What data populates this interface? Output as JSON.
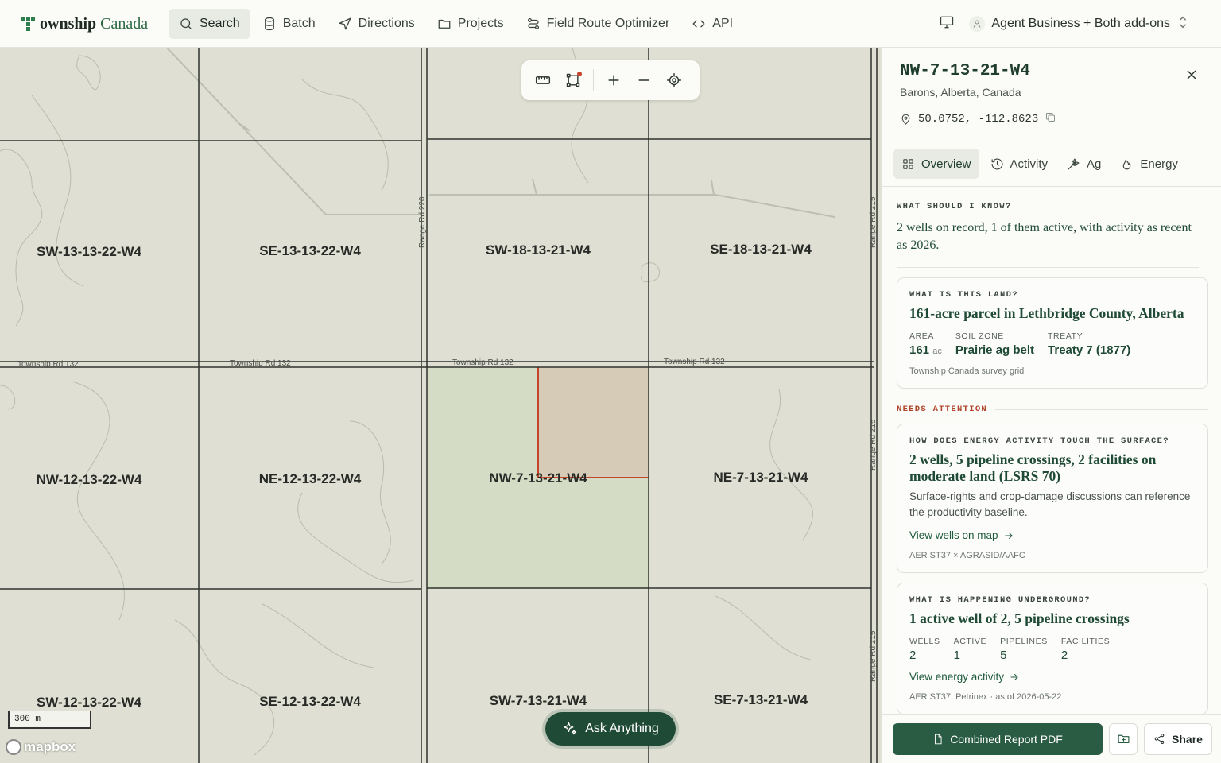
{
  "brand": {
    "name_bold": "ownship",
    "name_rest": " Canada"
  },
  "nav": {
    "items": [
      {
        "label": "Search",
        "icon": "search-icon",
        "active": true
      },
      {
        "label": "Batch",
        "icon": "database-icon"
      },
      {
        "label": "Directions",
        "icon": "navigation-icon"
      },
      {
        "label": "Projects",
        "icon": "folder-icon"
      },
      {
        "label": "Field Route Optimizer",
        "icon": "route-icon"
      },
      {
        "label": "API",
        "icon": "code-icon"
      }
    ],
    "account": "Agent Business + Both add-ons"
  },
  "map": {
    "parcels": [
      {
        "label": "SW-13-13-22-W4"
      },
      {
        "label": "SE-13-13-22-W4"
      },
      {
        "label": "SW-18-13-21-W4"
      },
      {
        "label": "SE-18-13-21-W4"
      },
      {
        "label": "NW-12-13-22-W4"
      },
      {
        "label": "NE-12-13-22-W4"
      },
      {
        "label": "NW-7-13-21-W4"
      },
      {
        "label": "NE-7-13-21-W4"
      },
      {
        "label": "SW-12-13-22-W4"
      },
      {
        "label": "SE-12-13-22-W4"
      },
      {
        "label": "SW-7-13-21-W4"
      },
      {
        "label": "SE-7-13-21-W4"
      }
    ],
    "roads": {
      "township": "Township Rd 132",
      "range_220": "Range Rd 220",
      "range_215": "Range Rd 215"
    },
    "scale": "300 m",
    "attribution": "mapbox",
    "ask_label": "Ask Anything",
    "colors": {
      "base": "#dfe0d3",
      "selected": "#d4dcc6",
      "highlight": "#d6cbb7",
      "highlight_border": "#c4452a"
    }
  },
  "panel": {
    "title": "NW-7-13-21-W4",
    "location": "Barons, Alberta, Canada",
    "coords": "50.0752, -112.8623",
    "tabs": [
      {
        "label": "Overview",
        "icon": "grid-icon",
        "active": true
      },
      {
        "label": "Activity",
        "icon": "history-icon"
      },
      {
        "label": "Ag",
        "icon": "wheat-icon"
      },
      {
        "label": "Energy",
        "icon": "flame-icon"
      }
    ],
    "know": {
      "eyebrow": "WHAT SHOULD I KNOW?",
      "text": "2 wells on record, 1 of them active, with activity as recent as 2026."
    },
    "land": {
      "eyebrow": "WHAT IS THIS LAND?",
      "title": "161-acre parcel in Lethbridge County, Alberta",
      "area_label": "AREA",
      "area_value": "161",
      "area_unit": "ac",
      "soil_label": "SOIL ZONE",
      "soil_value": "Prairie ag belt",
      "treaty_label": "TREATY",
      "treaty_value": "Treaty 7 (1877)",
      "source": "Township Canada survey grid"
    },
    "needs_attention": "NEEDS ATTENTION",
    "surface": {
      "eyebrow": "HOW DOES ENERGY ACTIVITY TOUCH THE SURFACE?",
      "title": "2 wells, 5 pipeline crossings, 2 facilities on moderate land (LSRS 70)",
      "text": "Surface-rights and crop-damage discussions can reference the productivity baseline.",
      "link": "View wells on map",
      "source": "AER ST37 × AGRASID/AAFC"
    },
    "underground": {
      "eyebrow": "WHAT IS HAPPENING UNDERGROUND?",
      "title": "1 active well of 2, 5 pipeline crossings",
      "stats": [
        {
          "label": "WELLS",
          "value": "2"
        },
        {
          "label": "ACTIVE",
          "value": "1"
        },
        {
          "label": "PIPELINES",
          "value": "5"
        },
        {
          "label": "FACILITIES",
          "value": "2"
        }
      ],
      "link": "View energy activity",
      "source": "AER ST37, Petrinex · as of 2026-05-22"
    },
    "footer": {
      "report": "Combined Report PDF",
      "share": "Share"
    }
  }
}
